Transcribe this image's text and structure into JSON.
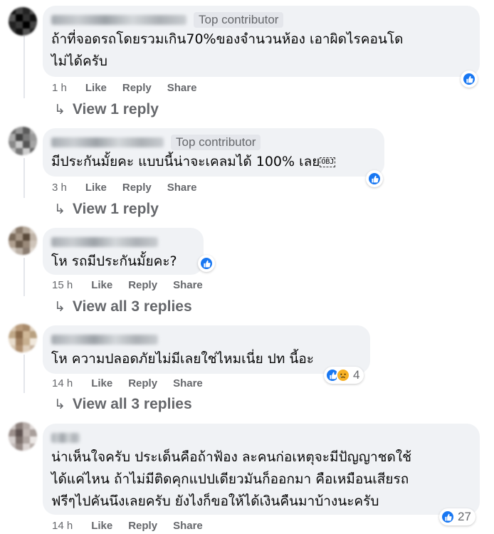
{
  "comments": [
    {
      "badge": "Top contributor",
      "text": "ถ้าที่จอดรถโดยรวมเกิน70%ของจำนวนห้อง เอาผิดไรคอนโด\nไม่ได้ครับ",
      "time": "1 h",
      "reaction_count": "",
      "replies": "View 1 reply"
    },
    {
      "badge": "Top contributor",
      "text": "มีประกันมั้ยคะ แบบนี้น่าจะเคลมได้ 100% เลย",
      "emoji_placeholder": "OBJ",
      "time": "3 h",
      "reaction_count": "",
      "replies": "View 1 reply"
    },
    {
      "badge": "",
      "text": "โห รถมีประกันมั้ยคะ?",
      "time": "15 h",
      "reaction_count": "",
      "replies": "View all 3 replies"
    },
    {
      "badge": "",
      "text": "โห ความปลอดภัยไม่มีเลยใช่ไหมเนี่ย ปท นี้อะ",
      "time": "14 h",
      "reaction_count": "4",
      "replies": "View all 3 replies"
    },
    {
      "badge": "",
      "text": "น่าเห็นใจครับ ประเด็นคือถ้าฟ้อง ละคนก่อเหตุจะมีปัญญาชดใช้\nได้แค่ไหน ถ้าไม่มีติดคุกแปปเดียวมันก็ออกมา คือเหมือนเสียรถ\nฟรีๆไปคันนึงเลยครับ ยังไงก็ขอให้ได้เงินคืนมาบ้างนะครับ",
      "time": "14 h",
      "reaction_count": "27",
      "replies": ""
    }
  ],
  "actions": {
    "like": "Like",
    "reply": "Reply",
    "share": "Share"
  },
  "icons": {
    "like": "like-reaction-icon",
    "sad": "sad-reaction-icon",
    "reply_arrow": "reply-arrow-icon"
  },
  "colors": {
    "bubble": "#f0f2f5",
    "like_blue": "#1877f2",
    "muted": "#65676b",
    "sad_yellow": "#f7b125"
  }
}
